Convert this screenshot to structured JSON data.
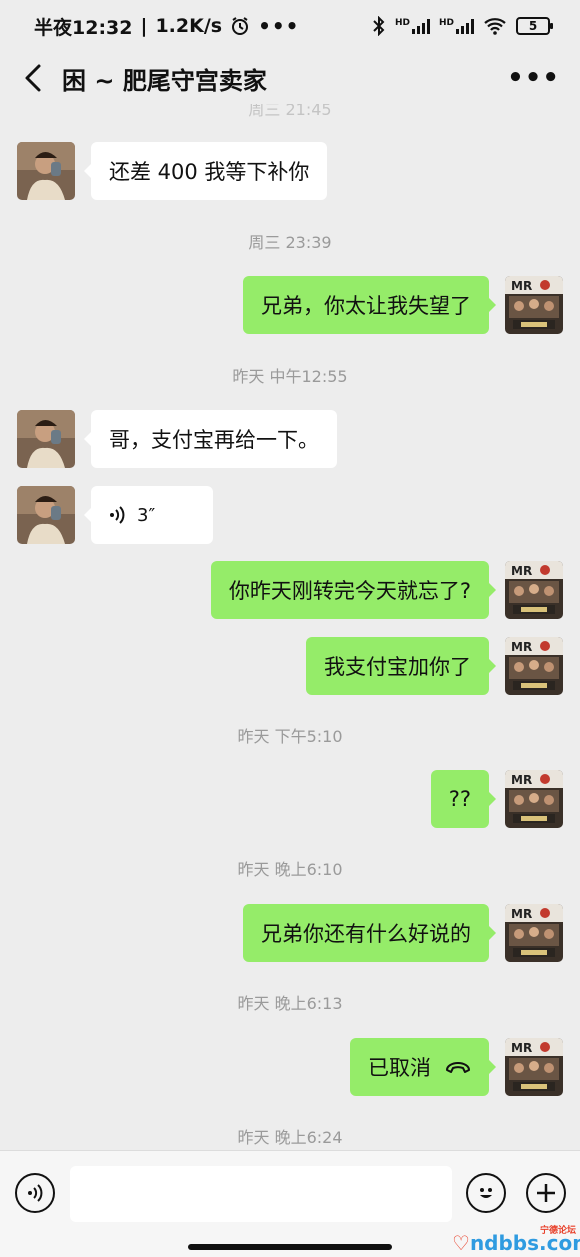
{
  "status": {
    "time": "半夜12:32",
    "speed": "1.2K/s",
    "signal_1": "HD",
    "signal_2": "HD",
    "battery": "5"
  },
  "nav": {
    "title": "困 ~ 肥尾守宫卖家"
  },
  "messages": [
    {
      "kind": "text",
      "side": "in",
      "text": "还差 400 我等下补你"
    },
    {
      "kind": "time",
      "text": "周三 23:39"
    },
    {
      "kind": "text",
      "side": "out",
      "text": "兄弟，你太让我失望了"
    },
    {
      "kind": "time",
      "text": "昨天 中午12:55"
    },
    {
      "kind": "text",
      "side": "in",
      "text": "哥，支付宝再给一下。"
    },
    {
      "kind": "voice",
      "side": "in",
      "duration": "3″"
    },
    {
      "kind": "text",
      "side": "out",
      "text": "你昨天刚转完今天就忘了?"
    },
    {
      "kind": "text",
      "side": "out",
      "text": "我支付宝加你了"
    },
    {
      "kind": "time",
      "text": "昨天 下午5:10"
    },
    {
      "kind": "text",
      "side": "out",
      "text": "??"
    },
    {
      "kind": "time",
      "text": "昨天 晚上6:10"
    },
    {
      "kind": "text",
      "side": "out",
      "text": "兄弟你还有什么好说的"
    },
    {
      "kind": "time",
      "text": "昨天 晚上6:13"
    },
    {
      "kind": "call",
      "side": "out",
      "text": "已取消"
    },
    {
      "kind": "time",
      "text": "昨天 晚上6:24"
    }
  ],
  "input": {
    "value": ""
  },
  "watermark": {
    "brand": "ndbbs.com",
    "tag": "宁德论坛"
  },
  "colors": {
    "background": "#ededed",
    "outgoing_bubble": "#95ec69",
    "incoming_bubble": "#ffffff",
    "timestamp": "#9a9a9a"
  }
}
